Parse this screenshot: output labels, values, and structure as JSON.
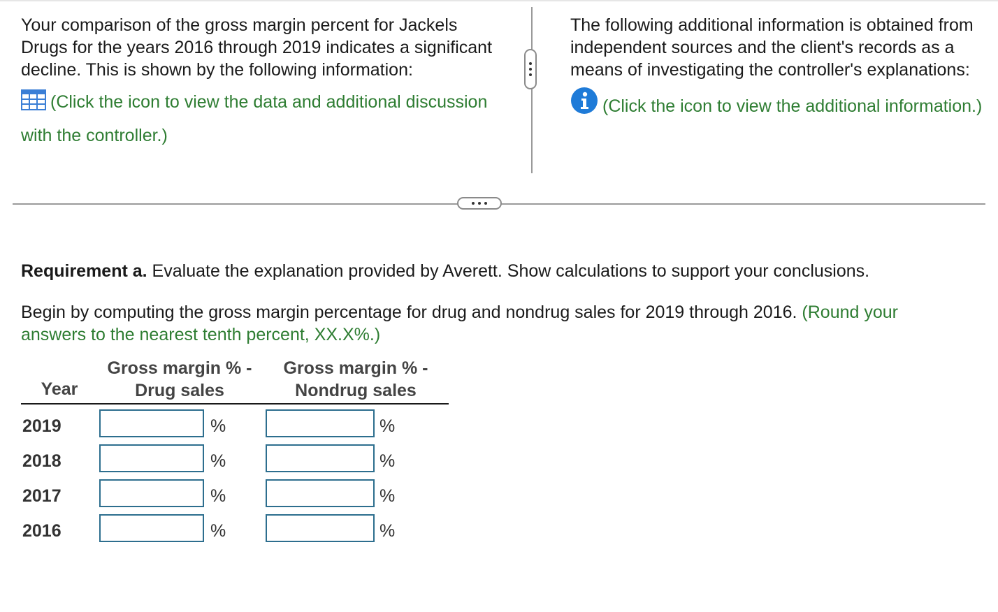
{
  "left_panel": {
    "text": "Your comparison of the gross margin percent for Jackels Drugs for the years 2016 through 2019 indicates a significant decline. This is shown by the following information:",
    "link": "(Click the icon to view the data and additional discussion with the controller.)",
    "icon": "data-table-icon"
  },
  "right_panel": {
    "text": "The following additional information is obtained from independent sources and the client's records as a means of investigating the controller's explanations:",
    "link": "(Click the icon to view the additional information.)",
    "icon": "info-icon"
  },
  "requirement": {
    "label": "Requirement a.",
    "text": " Evaluate the explanation provided by Averett. Show calculations to support your conclusions."
  },
  "instruction": {
    "text": "Begin by computing the gross margin percentage for drug and nondrug sales for 2019 through 2016. ",
    "hint": "(Round your answers to the nearest tenth percent, XX.X%.)"
  },
  "table": {
    "headers": {
      "year": "Year",
      "drug_line1": "Gross margin % -",
      "drug_line2": "Drug sales",
      "nondrug_line1": "Gross margin % -",
      "nondrug_line2": "Nondrug sales"
    },
    "unit": "%",
    "rows": [
      {
        "year": "2019",
        "drug": "",
        "nondrug": ""
      },
      {
        "year": "2018",
        "drug": "",
        "nondrug": ""
      },
      {
        "year": "2017",
        "drug": "",
        "nondrug": ""
      },
      {
        "year": "2016",
        "drug": "",
        "nondrug": ""
      }
    ]
  },
  "colors": {
    "link_green": "#2e7d32",
    "input_border": "#2d6e8e",
    "info_blue": "#1f7bd8",
    "grid_icon_blue": "#3b7fd6"
  }
}
